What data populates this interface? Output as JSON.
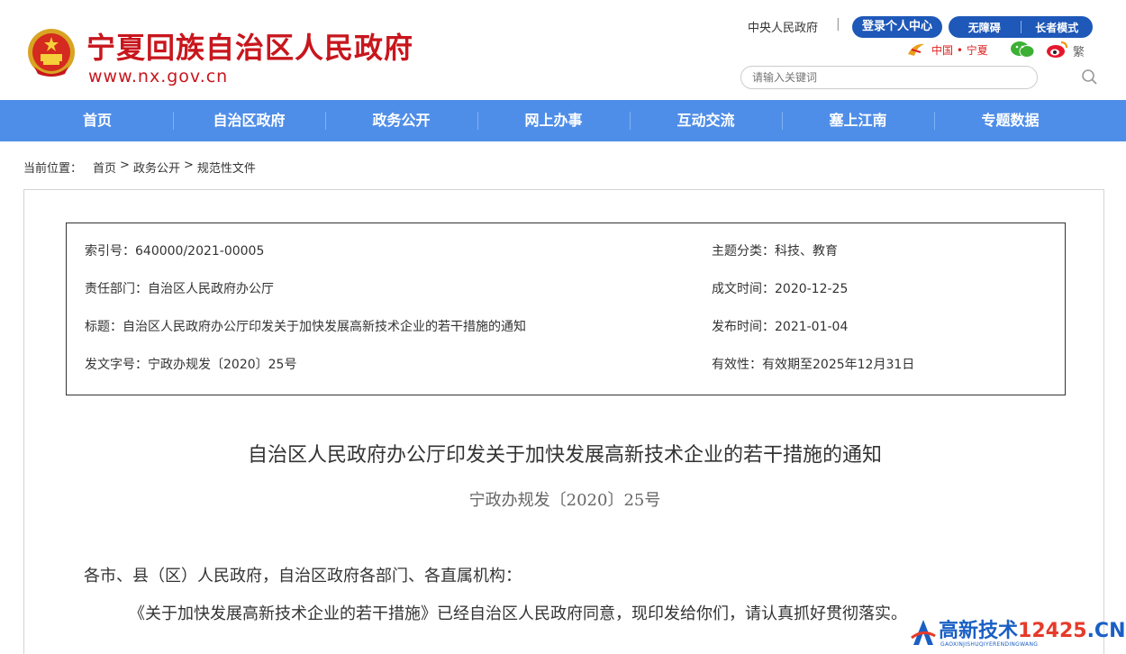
{
  "header": {
    "site_title": "宁夏回族自治区人民政府",
    "site_url": "www.nx.gov.cn",
    "top_link": "中央人民政府",
    "login_label": "登录个人中心",
    "accessible_label": "无障碍",
    "elder_label": "长者模式",
    "china_ningxia": "中国 • 宁夏",
    "traditional_label": "繁",
    "search_placeholder": "请输入关键词"
  },
  "nav": {
    "items": [
      "首页",
      "自治区政府",
      "政务公开",
      "网上办事",
      "互动交流",
      "塞上江南",
      "专题数据"
    ]
  },
  "breadcrumb": {
    "label": "当前位置：",
    "items": [
      "首页",
      ">",
      "政务公开",
      ">",
      "规范性文件"
    ]
  },
  "meta": {
    "index_no": "索引号：640000/2021-00005",
    "category": "主题分类：科技、教育",
    "department": "责任部门：自治区人民政府办公厅",
    "written_date": "成文时间：2020-12-25",
    "title": "标题：自治区人民政府办公厅印发关于加快发展高新技术企业的若干措施的通知",
    "publish_date": "发布时间：2021-01-04",
    "doc_no": "发文字号：宁政办规发〔2020〕25号",
    "validity": "有效性：有效期至2025年12月31日"
  },
  "document": {
    "title": "自治区人民政府办公厅印发关于加快发展高新技术企业的若干措施的通知",
    "number": "宁政办规发〔2020〕25号",
    "para1": "各市、县（区）人民政府，自治区政府各部门、各直属机构：",
    "para2": "《关于加快发展高新技术企业的若干措施》已经自治区人民政府同意，现印发给你们，请认真抓好贯彻落实。"
  },
  "watermark": {
    "main": "高新技术",
    "num": "12425",
    "suffix": ".CN",
    "sub": "GAOXINJISHUQIYERENDINGWANG"
  },
  "colors": {
    "brand_red": "#c8161d",
    "nav_blue": "#4f8ee8",
    "button_blue": "#1e58b8"
  }
}
